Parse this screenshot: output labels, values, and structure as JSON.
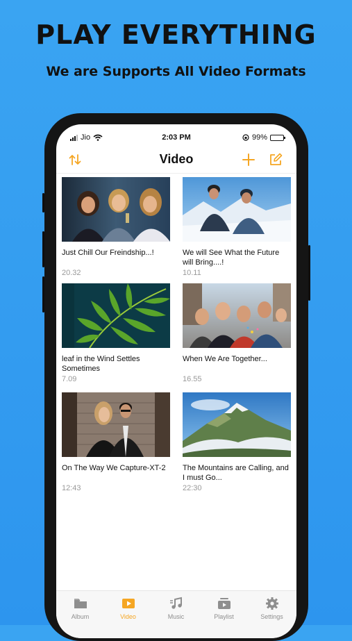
{
  "promo": {
    "headline": "PLAY EVERYTHING",
    "subline": "We are Supports All Video Formats"
  },
  "status_bar": {
    "carrier": "Jio",
    "time": "2:03 PM",
    "battery": "99%",
    "battery_level": 0.99
  },
  "nav": {
    "title": "Video",
    "sort_icon": "sort-arrows-icon",
    "add_icon": "plus-icon",
    "edit_icon": "edit-icon"
  },
  "videos": [
    {
      "title": "Just Chill Our Freindship...!",
      "duration": "20.32"
    },
    {
      "title": "We will See What the Future will Bring....!",
      "duration": "10.11"
    },
    {
      "title": "leaf in the Wind Settles Sometimes",
      "duration": "7.09"
    },
    {
      "title": "When We Are Together...",
      "duration": "16.55"
    },
    {
      "title": "On The Way We Capture-XT-2",
      "duration": "12:43"
    },
    {
      "title": "The Mountains are Calling, and I must Go...",
      "duration": "22:30"
    }
  ],
  "tabs": [
    {
      "label": "Album",
      "icon": "folder-icon"
    },
    {
      "label": "Video",
      "icon": "play-icon"
    },
    {
      "label": "Music",
      "icon": "music-note-icon"
    },
    {
      "label": "Playlist",
      "icon": "playlist-icon"
    },
    {
      "label": "Settings",
      "icon": "gear-icon"
    }
  ],
  "active_tab": "Video",
  "colors": {
    "background": "#2d95ee",
    "accent": "#f5a623",
    "text": "#111111",
    "muted": "#999999"
  }
}
